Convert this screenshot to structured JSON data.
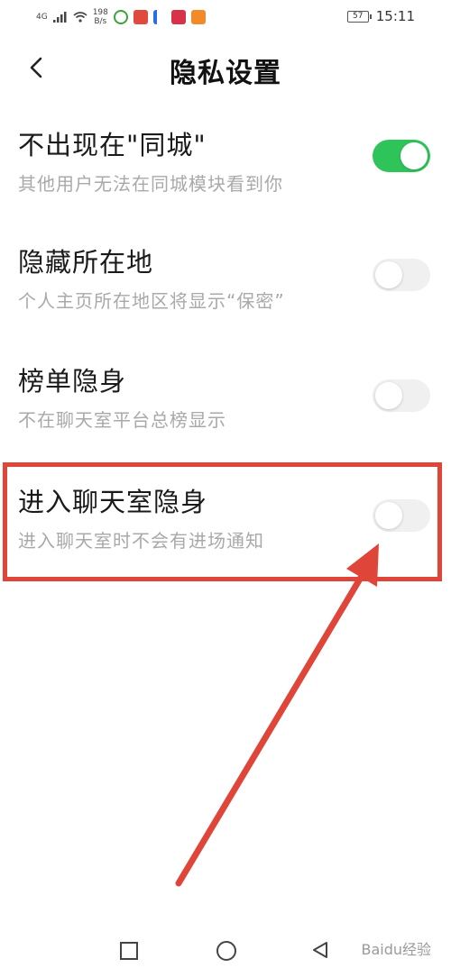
{
  "status_bar": {
    "network_label": "4G",
    "net_speed_value": "198",
    "net_speed_unit": "B/s",
    "battery_level": "57",
    "time": "15:11"
  },
  "header": {
    "title": "隐私设置",
    "back_icon": "chevron-left-icon"
  },
  "settings": [
    {
      "title": "不出现在\"同城\"",
      "description": "其他用户无法在同城模块看到你",
      "enabled": true
    },
    {
      "title": "隐藏所在地",
      "description": "个人主页所在地区将显示“保密”",
      "enabled": false
    },
    {
      "title": "榜单隐身",
      "description": "不在聊天室平台总榜显示",
      "enabled": false
    },
    {
      "title": "进入聊天室隐身",
      "description": "进入聊天室时不会有进场通知",
      "enabled": false
    }
  ],
  "colors": {
    "toggle_on": "#2fc45a",
    "toggle_off": "#f0f0f0",
    "annotation_red": "#e0453a"
  },
  "watermark": "Baidu经验"
}
